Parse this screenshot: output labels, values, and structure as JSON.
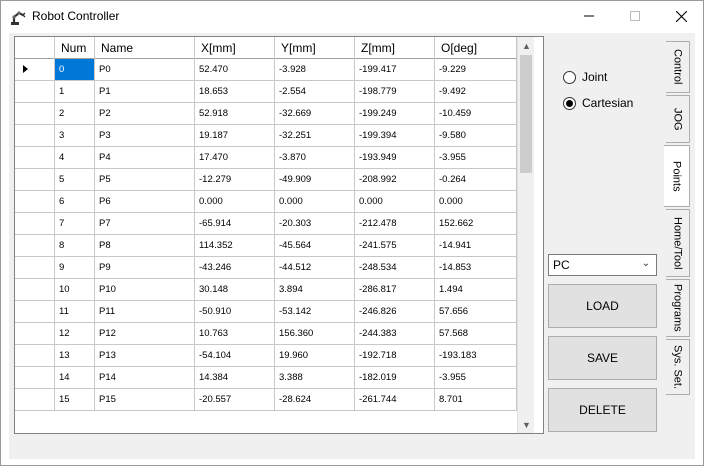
{
  "window": {
    "title": "Robot Controller",
    "min_glyph": "—",
    "max_glyph": "☐",
    "close_glyph": "✕"
  },
  "grid": {
    "columns": [
      "",
      "Num",
      "Name",
      "X[mm]",
      "Y[mm]",
      "Z[mm]",
      "O[deg]"
    ],
    "selected_row": 0,
    "rows": [
      [
        "0",
        "P0",
        "52.470",
        "-3.928",
        "-199.417",
        "-9.229"
      ],
      [
        "1",
        "P1",
        "18.653",
        "-2.554",
        "-198.779",
        "-9.492"
      ],
      [
        "2",
        "P2",
        "52.918",
        "-32.669",
        "-199.249",
        "-10.459"
      ],
      [
        "3",
        "P3",
        "19.187",
        "-32.251",
        "-199.394",
        "-9.580"
      ],
      [
        "4",
        "P4",
        "17.470",
        "-3.870",
        "-193.949",
        "-3.955"
      ],
      [
        "5",
        "P5",
        "-12.279",
        "-49.909",
        "-208.992",
        "-0.264"
      ],
      [
        "6",
        "P6",
        "0.000",
        "0.000",
        "0.000",
        "0.000"
      ],
      [
        "7",
        "P7",
        "-65.914",
        "-20.303",
        "-212.478",
        "152.662"
      ],
      [
        "8",
        "P8",
        "114.352",
        "-45.564",
        "-241.575",
        "-14.941"
      ],
      [
        "9",
        "P9",
        "-43.246",
        "-44.512",
        "-248.534",
        "-14.853"
      ],
      [
        "10",
        "P10",
        "30.148",
        "3.894",
        "-286.817",
        "1.494"
      ],
      [
        "11",
        "P11",
        "-50.910",
        "-53.142",
        "-246.826",
        "57.656"
      ],
      [
        "12",
        "P12",
        "10.763",
        "156.360",
        "-244.383",
        "57.568"
      ],
      [
        "13",
        "P13",
        "-54.104",
        "19.960",
        "-192.718",
        "-193.183"
      ],
      [
        "14",
        "P14",
        "14.384",
        "3.388",
        "-182.019",
        "-3.955"
      ],
      [
        "15",
        "P15",
        "-20.557",
        "-28.624",
        "-261.744",
        "8.701"
      ]
    ],
    "scroll_up": "▲",
    "scroll_down": "▼"
  },
  "mode": {
    "joint_label": "Joint",
    "cartesian_label": "Cartesian",
    "selected": "Cartesian"
  },
  "source": {
    "selected": "PC",
    "arrow": "⌄"
  },
  "buttons": {
    "load": "LOAD",
    "save": "SAVE",
    "delete": "DELETE"
  },
  "tabs": [
    {
      "label": "Control",
      "active": false
    },
    {
      "label": "JOG",
      "active": false
    },
    {
      "label": "Points",
      "active": true
    },
    {
      "label": "Home/Tool",
      "active": false
    },
    {
      "label": "Programs",
      "active": false
    },
    {
      "label": "Sys. Set.",
      "active": false
    }
  ]
}
